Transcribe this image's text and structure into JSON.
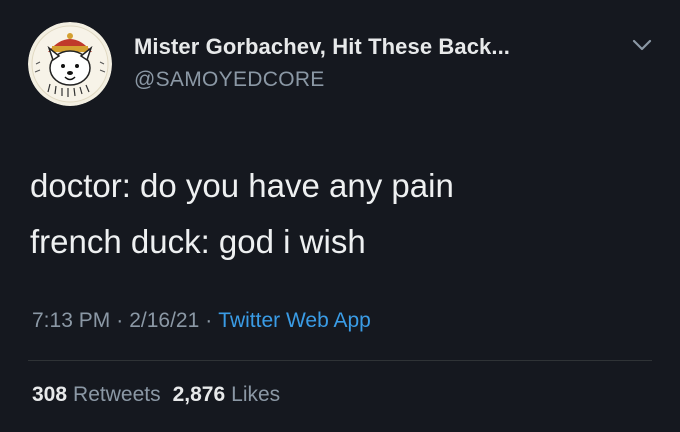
{
  "user": {
    "display_name": "Mister Gorbachev, Hit These Back...",
    "handle": "@SAMOYEDCORE",
    "avatar_icon": "samoyed-dog-avatar",
    "menu_icon": "chevron-down-icon"
  },
  "tweet": {
    "lines": [
      "doctor: do you have any pain",
      "french duck: god i wish"
    ]
  },
  "meta": {
    "time": "7:13 PM",
    "separator": "·",
    "date": "2/16/21",
    "source": "Twitter Web App"
  },
  "stats": {
    "retweets_count": "308",
    "retweets_label": "Retweets",
    "likes_count": "2,876",
    "likes_label": "Likes"
  },
  "colors": {
    "background": "#15181f",
    "text_primary": "#e7e9ea",
    "text_secondary": "#8b98a5",
    "link": "#3a9ce6"
  }
}
